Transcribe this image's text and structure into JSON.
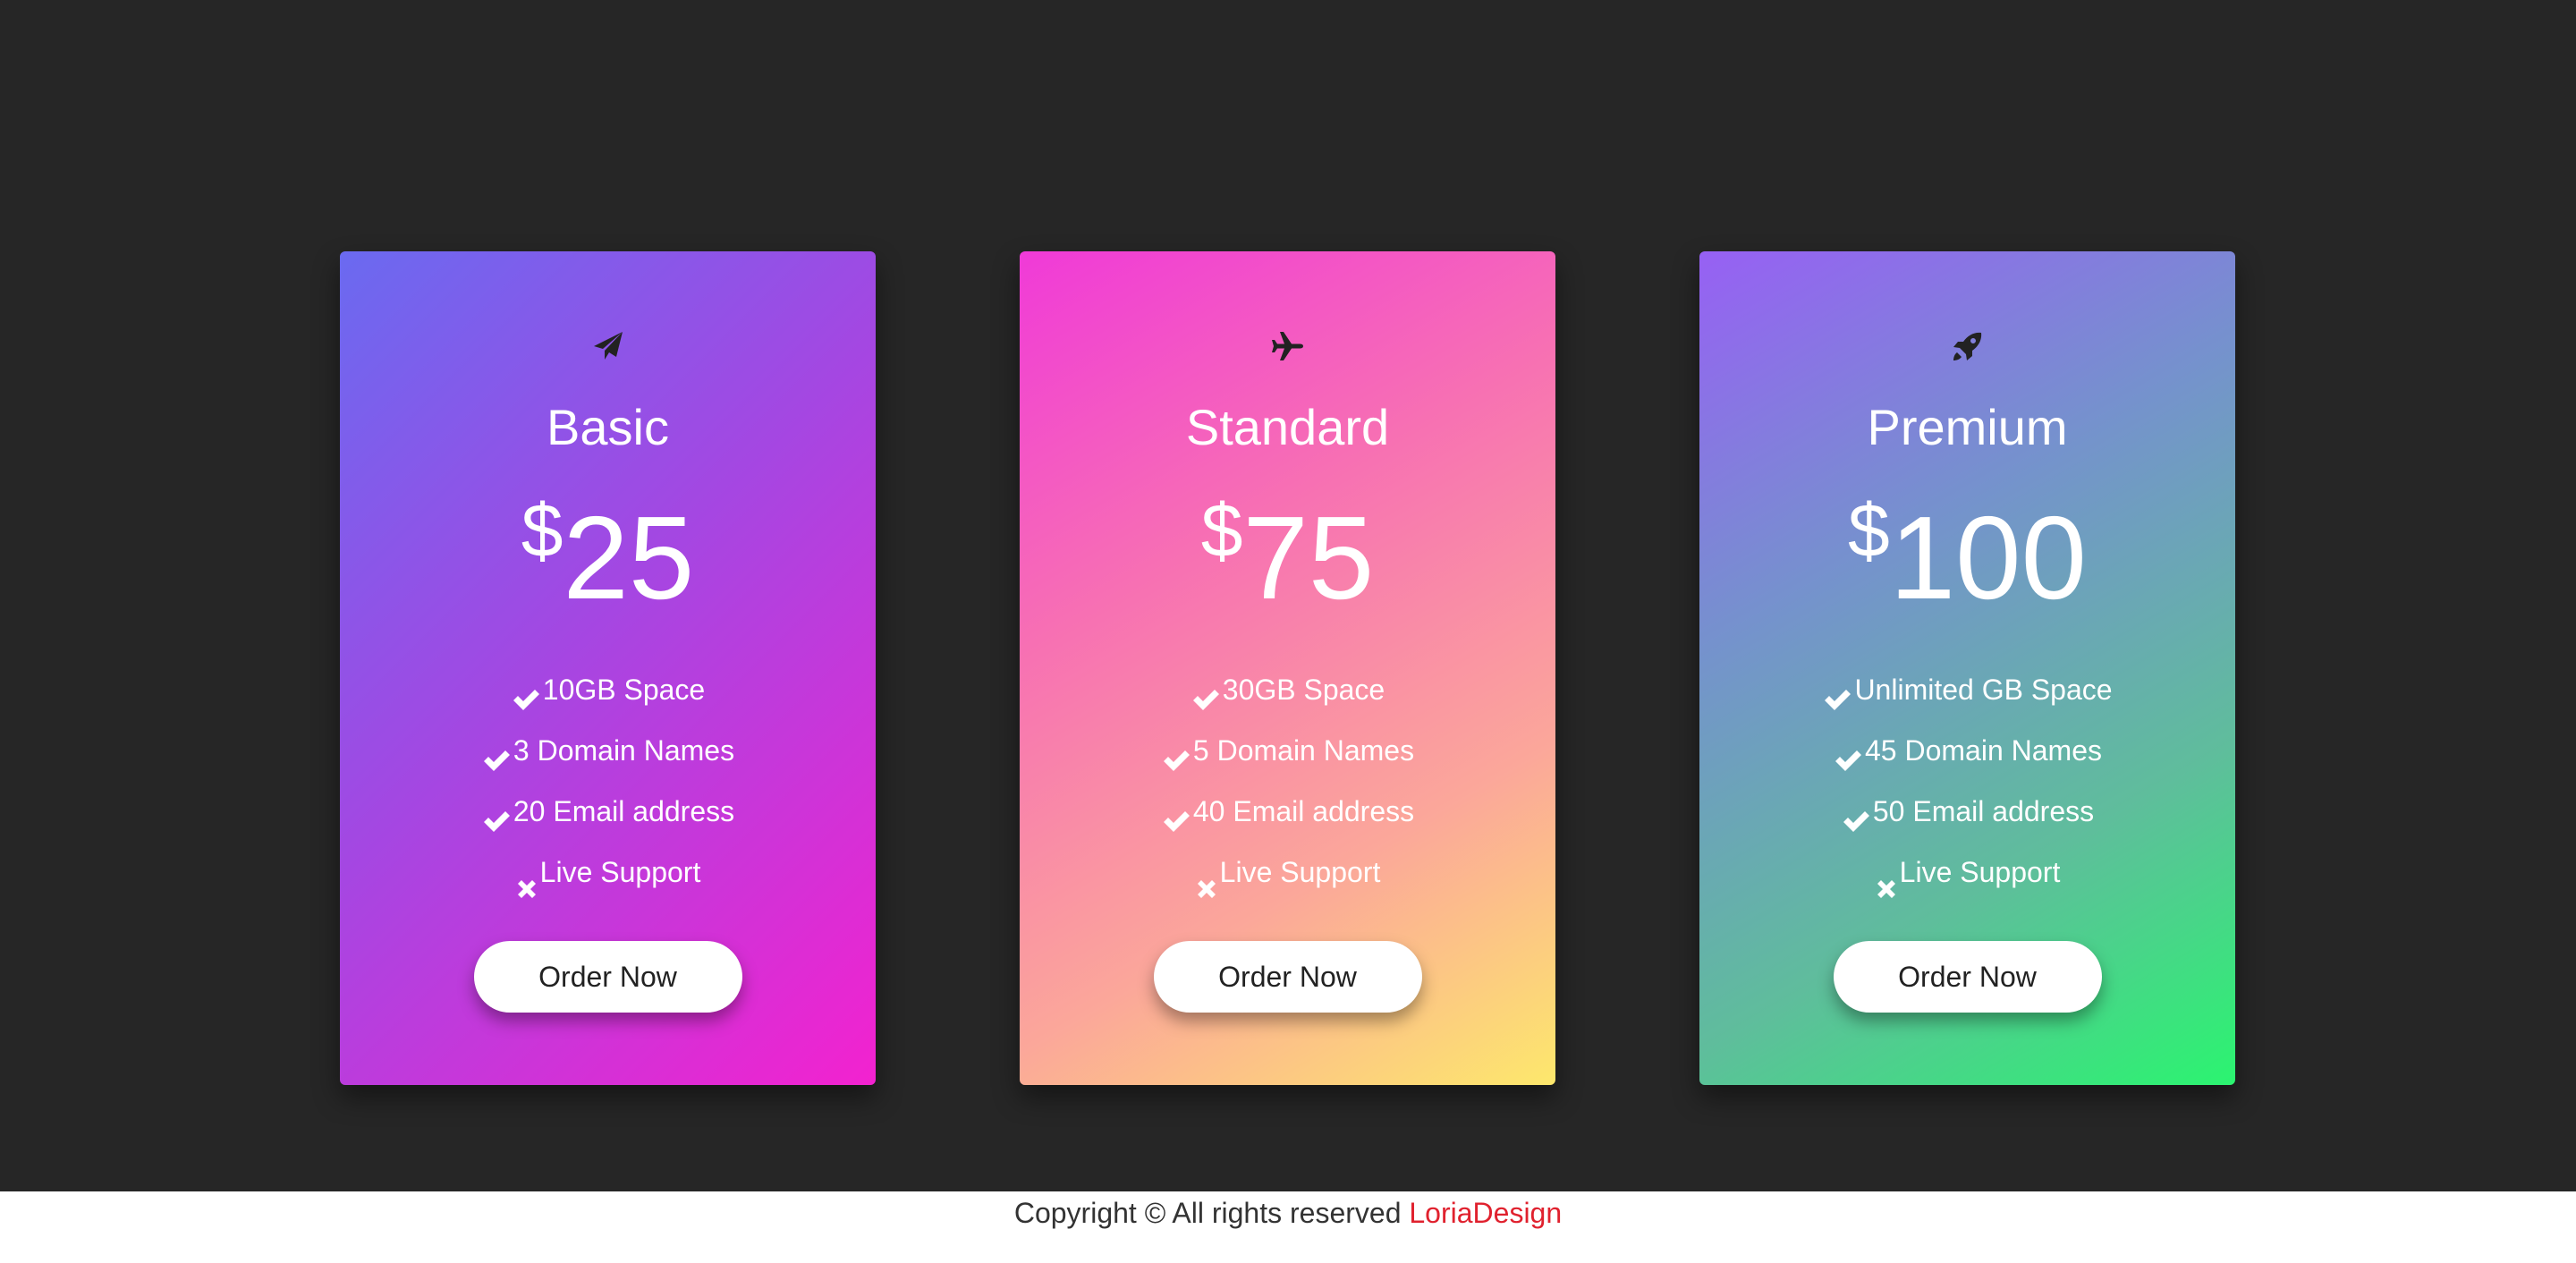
{
  "plans": [
    {
      "name": "Basic",
      "icon": "paper-plane-icon",
      "currency": "$",
      "price": "25",
      "features": [
        {
          "mark": "check-icon",
          "text": "10GB Space"
        },
        {
          "mark": "check-icon",
          "text": "3 Domain Names"
        },
        {
          "mark": "check-icon",
          "text": "20 Email address"
        },
        {
          "mark": "x-icon",
          "text": "Live Support"
        }
      ],
      "button_label": "Order Now",
      "gradient": [
        "#6a6af0",
        "#a447e2",
        "#f322cf"
      ]
    },
    {
      "name": "Standard",
      "icon": "airplane-icon",
      "currency": "$",
      "price": "75",
      "features": [
        {
          "mark": "check-icon",
          "text": "30GB Space"
        },
        {
          "mark": "check-icon",
          "text": "5 Domain Names"
        },
        {
          "mark": "check-icon",
          "text": "40 Email address"
        },
        {
          "mark": "x-icon",
          "text": "Live Support"
        }
      ],
      "button_label": "Order Now",
      "gradient": [
        "#f03ad8",
        "#fba79a",
        "#fde86c"
      ]
    },
    {
      "name": "Premium",
      "icon": "rocket-icon",
      "currency": "$",
      "price": "100",
      "features": [
        {
          "mark": "check-icon",
          "text": "Unlimited GB Space"
        },
        {
          "mark": "check-icon",
          "text": "45 Domain Names"
        },
        {
          "mark": "check-icon",
          "text": "50 Email address"
        },
        {
          "mark": "x-icon",
          "text": "Live Support"
        }
      ],
      "button_label": "Order Now",
      "gradient": [
        "#9760f4",
        "#5fbd9c",
        "#2bf470"
      ]
    }
  ],
  "footer": {
    "text": "Copyright © All rights reserved",
    "brand": "LoriaDesign",
    "brand_color": "#e0212e"
  },
  "colors": {
    "background": "#262626",
    "footer_background": "#ffffff"
  }
}
